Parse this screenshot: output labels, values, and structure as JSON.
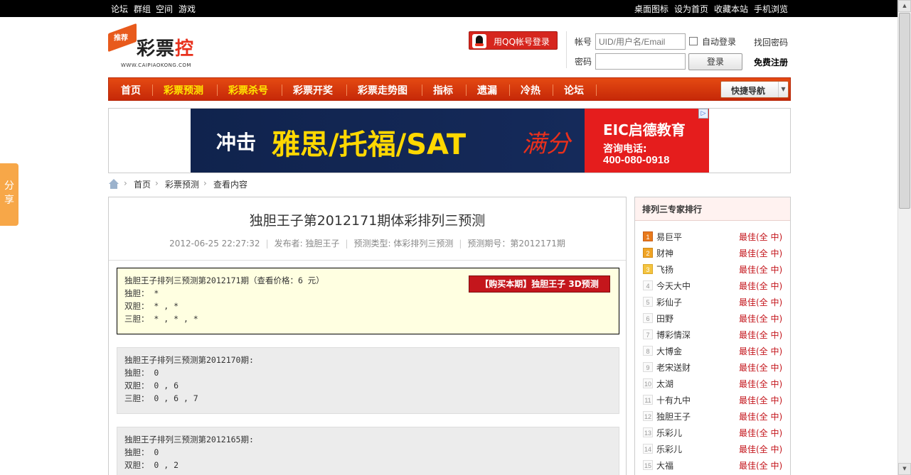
{
  "topbar": {
    "left_links": [
      "论坛",
      "群组",
      "空间",
      "游戏"
    ],
    "right_links": [
      "桌面图标",
      "设为首页",
      "收藏本站",
      "手机浏览"
    ]
  },
  "logo": {
    "tag": "推荐",
    "brand_a": "彩票",
    "brand_b": "控",
    "url": "WWW.CAIPIAOKONG.COM"
  },
  "login": {
    "qq_button": "用QQ帐号登录",
    "account_label": "帐号",
    "account_placeholder": "UID/用户名/Email",
    "auto_login": "自动登录",
    "forgot": "找回密码",
    "password_label": "密码",
    "submit": "登录",
    "register": "免费注册"
  },
  "nav": {
    "items": [
      "首页",
      "彩票预测",
      "彩票杀号",
      "彩票开奖",
      "彩票走势图",
      "指标",
      "遗漏",
      "冷热",
      "论坛"
    ],
    "quick": "快捷导航",
    "highlight_color": "#ffe600"
  },
  "banner": {
    "text1": "冲击",
    "text2": "雅思/托福/SAT",
    "text3": "满分",
    "brand": "EIC启德教育",
    "phone_label": "咨询电话:",
    "phone": "400-080-0918"
  },
  "breadcrumb": [
    "首页",
    "彩票预测",
    "查看内容"
  ],
  "article": {
    "title": "独胆王子第2012171期体彩排列三预测",
    "date": "2012-06-25 22:27:32",
    "author": "发布者: 独胆王子",
    "type": "预测类型: 体彩排列三预测",
    "issue": "预测期号：第2012171期",
    "current": {
      "heading": "独胆王子排列三预测第2012171期（查看价格：6 元）",
      "lines": [
        "独胆： *",
        "双胆： * , *",
        "三胆： * , * , *"
      ],
      "buy_button": "【购买本期】独胆王子 3D预测"
    },
    "past": [
      {
        "heading": "独胆王子排列三预测第2012170期:",
        "lines": [
          "独胆： 0",
          "双胆： 0 , 6",
          "三胆： 0 , 6 , 7"
        ]
      },
      {
        "heading": "独胆王子排列三预测第2012165期:",
        "lines": [
          "独胆： 0",
          "双胆： 0 , 2"
        ]
      }
    ]
  },
  "sidebar": {
    "title": "排列三专家排行",
    "badge": "最佳(全 中)",
    "experts": [
      "易巨平",
      "财神",
      "飞扬",
      "今天大中",
      "彩仙子",
      "田野",
      "博彩情深",
      "大博金",
      "老宋送财",
      "太湖",
      "十有九中",
      "独胆王子",
      "乐彩儿",
      "乐彩儿",
      "大福"
    ]
  },
  "share": "分享"
}
